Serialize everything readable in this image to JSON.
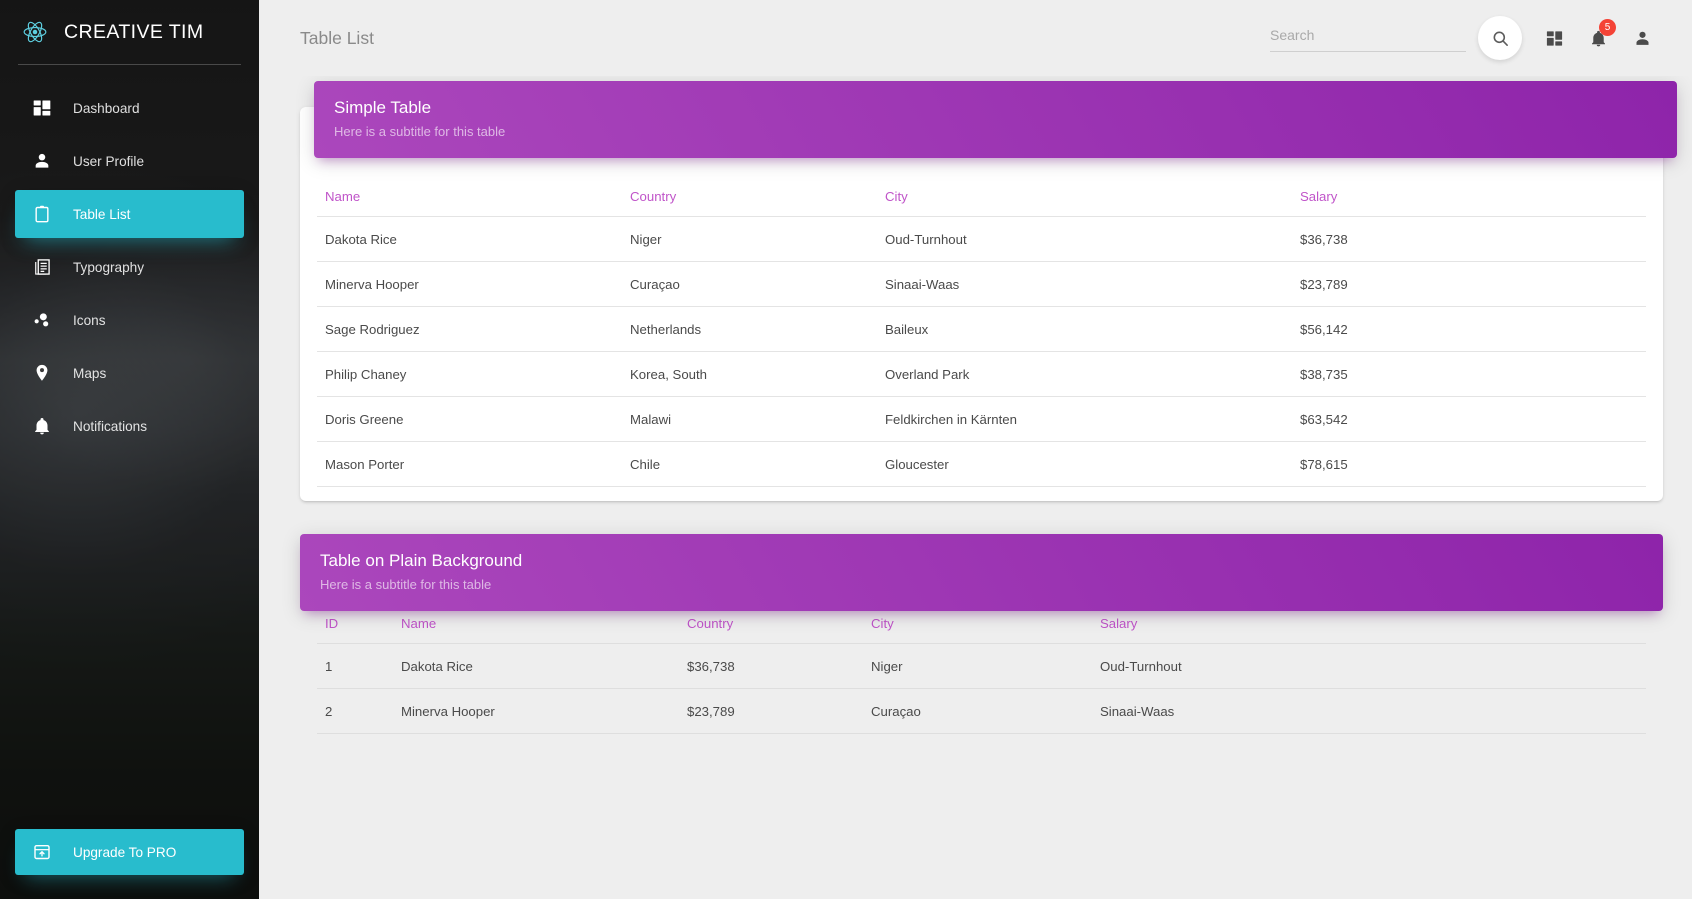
{
  "brand": {
    "name": "CREATIVE TIM",
    "logo_icon": "react-atom-icon",
    "accent_color": "#28bccd"
  },
  "sidebar": {
    "items": [
      {
        "label": "Dashboard",
        "icon": "dashboard-grid-icon",
        "active": false
      },
      {
        "label": "User Profile",
        "icon": "person-icon",
        "active": false
      },
      {
        "label": "Table List",
        "icon": "clipboard-icon",
        "active": true
      },
      {
        "label": "Typography",
        "icon": "article-text-icon",
        "active": false
      },
      {
        "label": "Icons",
        "icon": "bubble-chart-icon",
        "active": false
      },
      {
        "label": "Maps",
        "icon": "map-pin-icon",
        "active": false
      },
      {
        "label": "Notifications",
        "icon": "bell-icon",
        "active": false
      }
    ],
    "upgrade": {
      "label": "Upgrade To PRO",
      "icon": "unarchive-upload-icon"
    }
  },
  "topbar": {
    "title": "Table List",
    "search": {
      "value": "",
      "placeholder": "Search"
    },
    "search_button_icon": "search-icon",
    "dashboard_icon": "dashboard-grid-icon",
    "notifications_icon": "bell-icon",
    "notifications_badge": "5",
    "profile_icon": "person-icon"
  },
  "cards": [
    {
      "title": "Simple Table",
      "subtitle": "Here is a subtitle for this table",
      "columns": [
        "Name",
        "Country",
        "City",
        "Salary"
      ],
      "rows": [
        [
          "Dakota Rice",
          "Niger",
          "Oud-Turnhout",
          "$36,738"
        ],
        [
          "Minerva Hooper",
          "Curaçao",
          "Sinaai-Waas",
          "$23,789"
        ],
        [
          "Sage Rodriguez",
          "Netherlands",
          "Baileux",
          "$56,142"
        ],
        [
          "Philip Chaney",
          "Korea, South",
          "Overland Park",
          "$38,735"
        ],
        [
          "Doris Greene",
          "Malawi",
          "Feldkirchen in Kärnten",
          "$63,542"
        ],
        [
          "Mason Porter",
          "Chile",
          "Gloucester",
          "$78,615"
        ]
      ]
    },
    {
      "title": "Table on Plain Background",
      "subtitle": "Here is a subtitle for this table",
      "columns": [
        "ID",
        "Name",
        "Country",
        "City",
        "Salary"
      ],
      "rows": [
        [
          "1",
          "Dakota Rice",
          "$36,738",
          "Niger",
          "Oud-Turnhout"
        ],
        [
          "2",
          "Minerva Hooper",
          "$23,789",
          "Curaçao",
          "Sinaai-Waas"
        ]
      ]
    }
  ],
  "colors": {
    "accent_teal": "#28bccd",
    "header_purple_light": "#ab47bc",
    "header_purple_dark": "#8e24aa",
    "table_header_text": "#c054c9",
    "badge_red": "#f44336",
    "page_background": "#eeeeee"
  }
}
